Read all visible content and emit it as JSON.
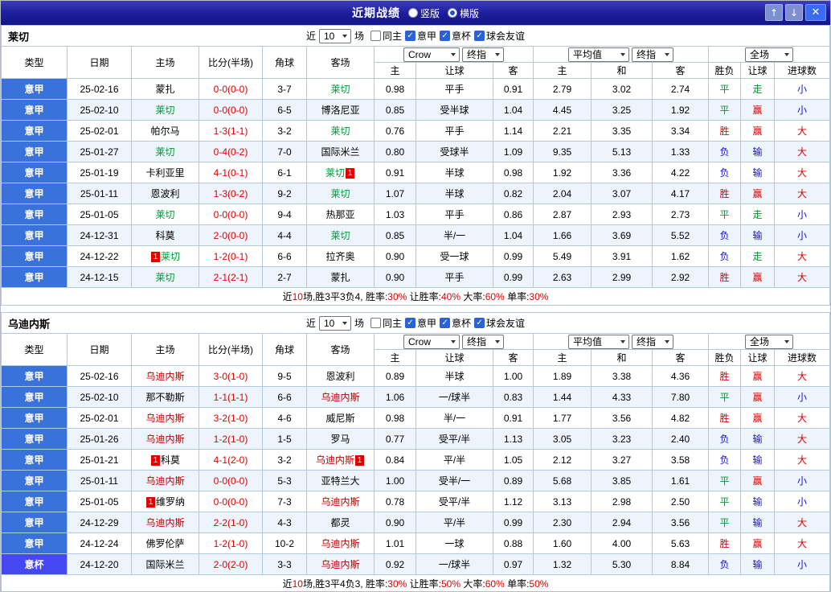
{
  "titlebar": {
    "title": "近期战绩",
    "options": [
      {
        "label": "竖版",
        "selected": false
      },
      {
        "label": "横版",
        "selected": true
      }
    ],
    "buttons": {
      "up": "↑",
      "down": "↓",
      "close": "✕"
    }
  },
  "icons": {
    "check": "✓"
  },
  "badges": {
    "red_card": "1"
  },
  "colors": {
    "type_league": {
      "意甲": "#3a72dc",
      "意杯": "#4747f2"
    },
    "focus_team": {
      "莱切": "#009933",
      "乌迪内斯": "#c00000"
    },
    "result": {
      "胜": "#e00000",
      "赢": "#e00000",
      "大": "#e00000",
      "平": "#009933",
      "走": "#009933",
      "负": "#1515cd",
      "输": "#1515cd",
      "小": "#1515cd"
    },
    "score": "#e00000"
  },
  "header": {
    "near": "近",
    "count": "10",
    "matches": "场",
    "checkboxes": [
      {
        "label": "同主",
        "checked": false
      },
      {
        "label": "意甲",
        "checked": true
      },
      {
        "label": "意杯",
        "checked": true
      },
      {
        "label": "球会友谊",
        "checked": true
      }
    ],
    "cols": {
      "type": "类型",
      "date": "日期",
      "home": "主场",
      "score": "比分(半场)",
      "corner": "角球",
      "away": "客场"
    },
    "odds_group": {
      "bookmaker": "Crow",
      "final": "终指",
      "sub": [
        "主",
        "让球",
        "客"
      ]
    },
    "avg_group": {
      "label": "平均值",
      "final": "终指",
      "sub": [
        "主",
        "和",
        "客"
      ]
    },
    "result_group": {
      "label": "全场",
      "sub": [
        "胜负",
        "让球",
        "进球数"
      ]
    }
  },
  "tables": [
    {
      "team": "莱切",
      "focus": "莱切",
      "rows": [
        {
          "type": "意甲",
          "date": "25-02-16",
          "home": "蒙扎",
          "score": "0-0(0-0)",
          "corner": "3-7",
          "away": "莱切",
          "odds": [
            "0.98",
            "平手",
            "0.91"
          ],
          "avg": [
            "2.79",
            "3.02",
            "2.74"
          ],
          "res": [
            "平",
            "走",
            "小"
          ]
        },
        {
          "type": "意甲",
          "date": "25-02-10",
          "home": "莱切",
          "score": "0-0(0-0)",
          "corner": "6-5",
          "away": "博洛尼亚",
          "odds": [
            "0.85",
            "受半球",
            "1.04"
          ],
          "avg": [
            "4.45",
            "3.25",
            "1.92"
          ],
          "res": [
            "平",
            "赢",
            "小"
          ]
        },
        {
          "type": "意甲",
          "date": "25-02-01",
          "home": "帕尔马",
          "score": "1-3(1-1)",
          "corner": "3-2",
          "away": "莱切",
          "odds": [
            "0.76",
            "平手",
            "1.14"
          ],
          "avg": [
            "2.21",
            "3.35",
            "3.34"
          ],
          "res": [
            "胜",
            "赢",
            "大"
          ]
        },
        {
          "type": "意甲",
          "date": "25-01-27",
          "home": "莱切",
          "score": "0-4(0-2)",
          "corner": "7-0",
          "away": "国际米兰",
          "odds": [
            "0.80",
            "受球半",
            "1.09"
          ],
          "avg": [
            "9.35",
            "5.13",
            "1.33"
          ],
          "res": [
            "负",
            "输",
            "大"
          ]
        },
        {
          "type": "意甲",
          "date": "25-01-19",
          "home": "卡利亚里",
          "score": "4-1(0-1)",
          "corner": "6-1",
          "away": "莱切",
          "away_rc": "post",
          "odds": [
            "0.91",
            "半球",
            "0.98"
          ],
          "avg": [
            "1.92",
            "3.36",
            "4.22"
          ],
          "res": [
            "负",
            "输",
            "大"
          ]
        },
        {
          "type": "意甲",
          "date": "25-01-11",
          "home": "恩波利",
          "score": "1-3(0-2)",
          "corner": "9-2",
          "away": "莱切",
          "odds": [
            "1.07",
            "半球",
            "0.82"
          ],
          "avg": [
            "2.04",
            "3.07",
            "4.17"
          ],
          "res": [
            "胜",
            "赢",
            "大"
          ]
        },
        {
          "type": "意甲",
          "date": "25-01-05",
          "home": "莱切",
          "score": "0-0(0-0)",
          "corner": "9-4",
          "away": "热那亚",
          "odds": [
            "1.03",
            "平手",
            "0.86"
          ],
          "avg": [
            "2.87",
            "2.93",
            "2.73"
          ],
          "res": [
            "平",
            "走",
            "小"
          ]
        },
        {
          "type": "意甲",
          "date": "24-12-31",
          "home": "科莫",
          "score": "2-0(0-0)",
          "corner": "4-4",
          "away": "莱切",
          "odds": [
            "0.85",
            "半/一",
            "1.04"
          ],
          "avg": [
            "1.66",
            "3.69",
            "5.52"
          ],
          "res": [
            "负",
            "输",
            "小"
          ]
        },
        {
          "type": "意甲",
          "date": "24-12-22",
          "home": "莱切",
          "home_rc": "pre",
          "score": "1-2(0-1)",
          "corner": "6-6",
          "away": "拉齐奥",
          "odds": [
            "0.90",
            "受一球",
            "0.99"
          ],
          "avg": [
            "5.49",
            "3.91",
            "1.62"
          ],
          "res": [
            "负",
            "走",
            "大"
          ]
        },
        {
          "type": "意甲",
          "date": "24-12-15",
          "home": "莱切",
          "score": "2-1(2-1)",
          "corner": "2-7",
          "away": "蒙扎",
          "odds": [
            "0.90",
            "平手",
            "0.99"
          ],
          "avg": [
            "2.63",
            "2.99",
            "2.92"
          ],
          "res": [
            "胜",
            "赢",
            "大"
          ]
        }
      ],
      "summary": [
        {
          "t": "近"
        },
        {
          "t": "10",
          "red": true
        },
        {
          "t": "场,胜3平3负4, 胜率:"
        },
        {
          "t": "30%",
          "red": true
        },
        {
          "t": " 让胜率:"
        },
        {
          "t": "40%",
          "red": true
        },
        {
          "t": " 大率:"
        },
        {
          "t": "60%",
          "red": true
        },
        {
          "t": " 单率:"
        },
        {
          "t": "30%",
          "red": true
        }
      ]
    },
    {
      "team": "乌迪内斯",
      "focus": "乌迪内斯",
      "rows": [
        {
          "type": "意甲",
          "date": "25-02-16",
          "home": "乌迪内斯",
          "score": "3-0(1-0)",
          "corner": "9-5",
          "away": "恩波利",
          "odds": [
            "0.89",
            "半球",
            "1.00"
          ],
          "avg": [
            "1.89",
            "3.38",
            "4.36"
          ],
          "res": [
            "胜",
            "赢",
            "大"
          ]
        },
        {
          "type": "意甲",
          "date": "25-02-10",
          "home": "那不勒斯",
          "score": "1-1(1-1)",
          "corner": "6-6",
          "away": "乌迪内斯",
          "odds": [
            "1.06",
            "一/球半",
            "0.83"
          ],
          "avg": [
            "1.44",
            "4.33",
            "7.80"
          ],
          "res": [
            "平",
            "赢",
            "小"
          ]
        },
        {
          "type": "意甲",
          "date": "25-02-01",
          "home": "乌迪内斯",
          "score": "3-2(1-0)",
          "corner": "4-6",
          "away": "威尼斯",
          "odds": [
            "0.98",
            "半/一",
            "0.91"
          ],
          "avg": [
            "1.77",
            "3.56",
            "4.82"
          ],
          "res": [
            "胜",
            "赢",
            "大"
          ]
        },
        {
          "type": "意甲",
          "date": "25-01-26",
          "home": "乌迪内斯",
          "score": "1-2(1-0)",
          "corner": "1-5",
          "away": "罗马",
          "odds": [
            "0.77",
            "受平/半",
            "1.13"
          ],
          "avg": [
            "3.05",
            "3.23",
            "2.40"
          ],
          "res": [
            "负",
            "输",
            "大"
          ]
        },
        {
          "type": "意甲",
          "date": "25-01-21",
          "home": "科莫",
          "home_rc": "pre",
          "score": "4-1(2-0)",
          "corner": "3-2",
          "away": "乌迪内斯",
          "away_rc": "post",
          "odds": [
            "0.84",
            "平/半",
            "1.05"
          ],
          "avg": [
            "2.12",
            "3.27",
            "3.58"
          ],
          "res": [
            "负",
            "输",
            "大"
          ]
        },
        {
          "type": "意甲",
          "date": "25-01-11",
          "home": "乌迪内斯",
          "score": "0-0(0-0)",
          "corner": "5-3",
          "away": "亚特兰大",
          "odds": [
            "1.00",
            "受半/一",
            "0.89"
          ],
          "avg": [
            "5.68",
            "3.85",
            "1.61"
          ],
          "res": [
            "平",
            "赢",
            "小"
          ]
        },
        {
          "type": "意甲",
          "date": "25-01-05",
          "home": "维罗纳",
          "home_rc": "pre",
          "score": "0-0(0-0)",
          "corner": "7-3",
          "away": "乌迪内斯",
          "odds": [
            "0.78",
            "受平/半",
            "1.12"
          ],
          "avg": [
            "3.13",
            "2.98",
            "2.50"
          ],
          "res": [
            "平",
            "输",
            "小"
          ]
        },
        {
          "type": "意甲",
          "date": "24-12-29",
          "home": "乌迪内斯",
          "score": "2-2(1-0)",
          "corner": "4-3",
          "away": "都灵",
          "odds": [
            "0.90",
            "平/半",
            "0.99"
          ],
          "avg": [
            "2.30",
            "2.94",
            "3.56"
          ],
          "res": [
            "平",
            "输",
            "大"
          ]
        },
        {
          "type": "意甲",
          "date": "24-12-24",
          "home": "佛罗伦萨",
          "score": "1-2(1-0)",
          "corner": "10-2",
          "away": "乌迪内斯",
          "odds": [
            "1.01",
            "一球",
            "0.88"
          ],
          "avg": [
            "1.60",
            "4.00",
            "5.63"
          ],
          "res": [
            "胜",
            "赢",
            "大"
          ]
        },
        {
          "type": "意杯",
          "date": "24-12-20",
          "home": "国际米兰",
          "score": "2-0(2-0)",
          "corner": "3-3",
          "away": "乌迪内斯",
          "odds": [
            "0.92",
            "一/球半",
            "0.97"
          ],
          "avg": [
            "1.32",
            "5.30",
            "8.84"
          ],
          "res": [
            "负",
            "输",
            "小"
          ]
        }
      ],
      "summary": [
        {
          "t": "近"
        },
        {
          "t": "10",
          "red": true
        },
        {
          "t": "场,胜3平4负3, 胜率:"
        },
        {
          "t": "30%",
          "red": true
        },
        {
          "t": " 让胜率:"
        },
        {
          "t": "50%",
          "red": true
        },
        {
          "t": " 大率:"
        },
        {
          "t": "60%",
          "red": true
        },
        {
          "t": " 单率:"
        },
        {
          "t": "50%",
          "red": true
        }
      ]
    }
  ]
}
